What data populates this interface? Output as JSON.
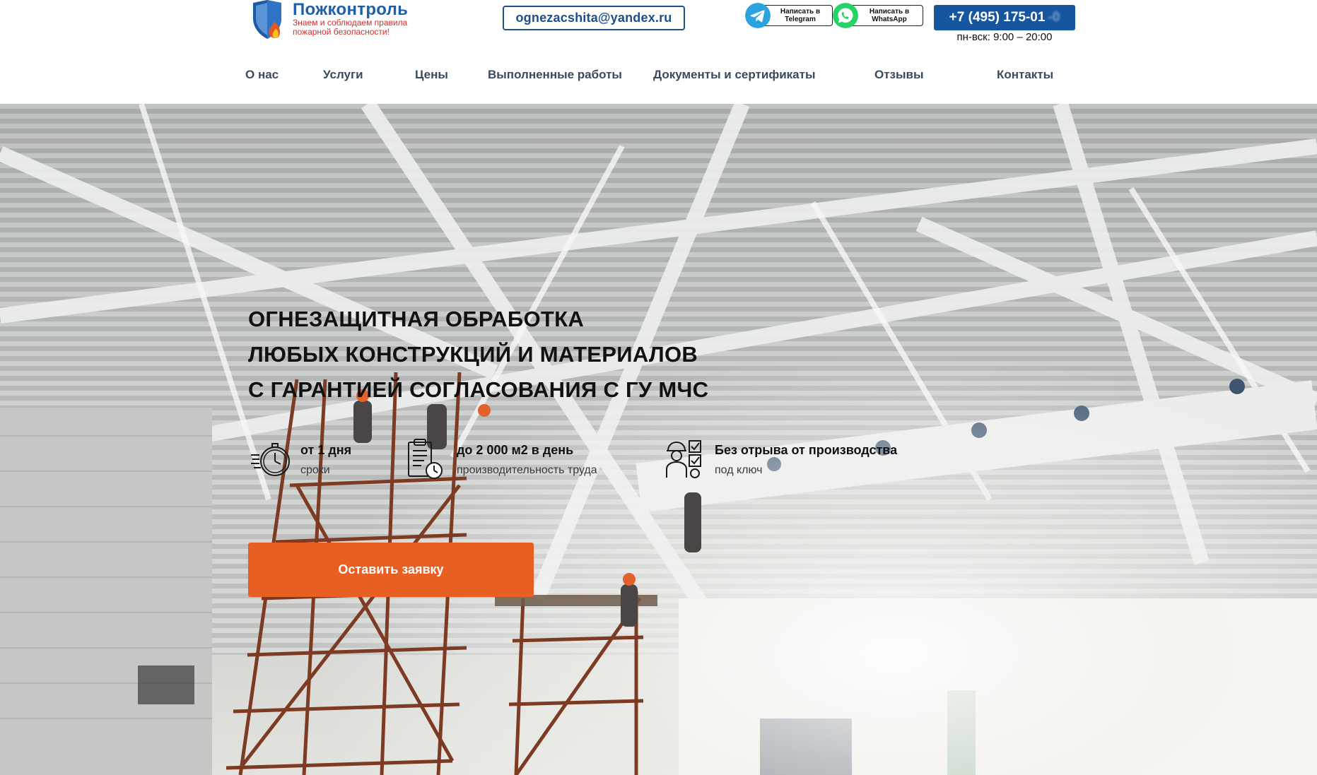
{
  "header": {
    "logo": {
      "name": "Пожконтроль",
      "slogan_line1": "Знаем и соблюдаем правила",
      "slogan_line2": "пожарной безопасности!",
      "icon": "shield-flame-icon"
    },
    "email": "ognezacshita@yandex.ru",
    "messengers": [
      {
        "line1": "Написать в",
        "line2": "Telegram",
        "icon": "telegram-icon",
        "color": "#2aa3e0"
      },
      {
        "line1": "Написать в",
        "line2": "WhatsApp",
        "icon": "whatsapp-icon",
        "color": "#25d366"
      }
    ],
    "phone": {
      "visible": "+7 (495) 175-01",
      "faded": "-0"
    },
    "hours": "пн-вск: 9:00 – 20:00"
  },
  "nav": [
    {
      "label": "О нас"
    },
    {
      "label": "Услуги"
    },
    {
      "label": "Цены"
    },
    {
      "label": "Выполненные работы"
    },
    {
      "label": "Документы и сертификаты"
    },
    {
      "label": "Отзывы"
    },
    {
      "label": "Контакты"
    }
  ],
  "hero": {
    "title": [
      "ОГНЕЗАЩИТНАЯ ОБРАБОТКА",
      "ЛЮБЫХ КОНСТРУКЦИЙ И МАТЕРИАЛОВ",
      "С ГАРАНТИЕЙ СОГЛАСОВАНИЯ С ГУ МЧС"
    ],
    "features": [
      {
        "title": "от 1 дня",
        "subtitle": "сроки",
        "icon": "stopwatch-icon"
      },
      {
        "title": "до 2 000 м2 в день",
        "subtitle": "производительность труда",
        "icon": "clipboard-clock-icon"
      },
      {
        "title": "Без отрыва от производства",
        "subtitle": "под ключ",
        "icon": "worker-checklist-icon"
      }
    ],
    "cta_label": "Оставить заявку",
    "background": "photo-interior-roof-trusses-scaffolding"
  },
  "colors": {
    "brand_blue": "#1655a0",
    "accent_orange": "#e85f23",
    "slogan_red": "#d1302c"
  }
}
